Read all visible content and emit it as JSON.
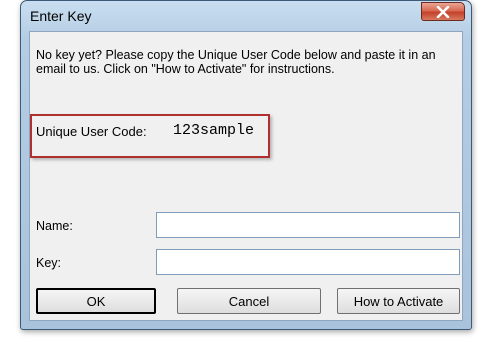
{
  "window": {
    "title": "Enter Key"
  },
  "message": "No key yet? Please copy the Unique User Code below and paste it in an email to us. Click on \"How to Activate\" for instructions.",
  "user_code": {
    "label": "Unique User Code:",
    "value": "123sample"
  },
  "form": {
    "name_label": "Name:",
    "name_value": "",
    "key_label": "Key:",
    "key_value": ""
  },
  "buttons": {
    "ok": "OK",
    "cancel": "Cancel",
    "how_to_activate": "How to Activate"
  },
  "colors": {
    "highlight_border": "#b03030",
    "close_button": "#c5412a"
  },
  "icons": {
    "close": "close-icon"
  }
}
